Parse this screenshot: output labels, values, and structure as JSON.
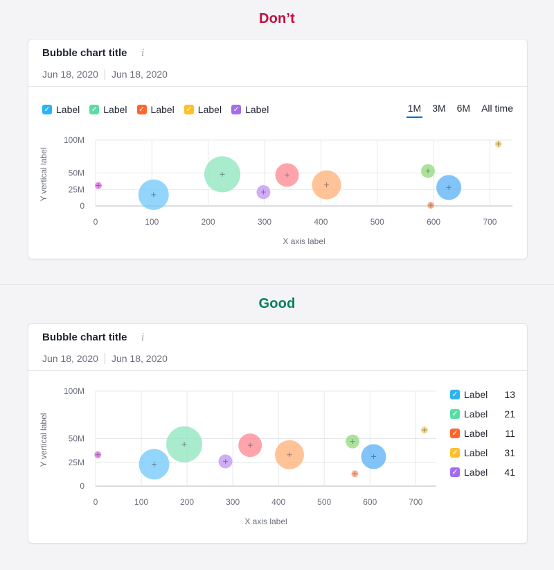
{
  "dont_heading": "Don’t",
  "good_heading": "Good",
  "card": {
    "title": "Bubble chart title",
    "info_icon": "i",
    "date_from": "Jun 18, 2020",
    "date_to": "Jun 18, 2020"
  },
  "legend": [
    {
      "label": "Label",
      "value": "13",
      "color": "#2bb3f3"
    },
    {
      "label": "Label",
      "value": "21",
      "color": "#59dda5"
    },
    {
      "label": "Label",
      "value": "11",
      "color": "#ff642d"
    },
    {
      "label": "Label",
      "value": "31",
      "color": "#ffbf2a"
    },
    {
      "label": "Label",
      "value": "41",
      "color": "#a56cf0"
    }
  ],
  "periods": [
    "1M",
    "3M",
    "6M",
    "All time"
  ],
  "active_period": "1M",
  "chart_data": [
    {
      "type": "scatter",
      "title": "",
      "xlabel": "X axis label",
      "ylabel": "Y vertical label",
      "xlim": [
        0,
        740
      ],
      "ylim": [
        0,
        100
      ],
      "x_ticks": [
        "0",
        "100",
        "200",
        "300",
        "400",
        "500",
        "600",
        "700"
      ],
      "y_ticks": [
        "0",
        "25M",
        "50M",
        "100M"
      ],
      "grid": true,
      "legend_position": "top",
      "points": [
        {
          "x": 5,
          "y": 31,
          "size": 5,
          "color": "#e070e8"
        },
        {
          "x": 103,
          "y": 17,
          "size": 22,
          "color": "#75c9fa"
        },
        {
          "x": 225,
          "y": 48,
          "size": 26,
          "color": "#8fe6bf"
        },
        {
          "x": 298,
          "y": 21,
          "size": 10,
          "color": "#c197f5"
        },
        {
          "x": 340,
          "y": 47,
          "size": 17,
          "color": "#ff8a93"
        },
        {
          "x": 410,
          "y": 32,
          "size": 21,
          "color": "#ffb27a"
        },
        {
          "x": 590,
          "y": 53,
          "size": 10,
          "color": "#96da80"
        },
        {
          "x": 595,
          "y": 1,
          "size": 5,
          "color": "#ff9f74"
        },
        {
          "x": 627,
          "y": 28,
          "size": 18,
          "color": "#5fb2f6"
        },
        {
          "x": 715,
          "y": 94,
          "size": 5,
          "color": "#ffd066"
        }
      ]
    },
    {
      "type": "scatter",
      "title": "",
      "xlabel": "X axis label",
      "ylabel": "Y vertical label",
      "xlim": [
        0,
        745
      ],
      "ylim": [
        0,
        100
      ],
      "x_ticks": [
        "0",
        "100",
        "200",
        "300",
        "400",
        "500",
        "600",
        "700"
      ],
      "y_ticks": [
        "0",
        "25M",
        "50M",
        "100M"
      ],
      "grid": true,
      "legend_position": "right",
      "points": [
        {
          "x": 5,
          "y": 33,
          "size": 5,
          "color": "#e070e8"
        },
        {
          "x": 128,
          "y": 23,
          "size": 22,
          "color": "#75c9fa"
        },
        {
          "x": 194,
          "y": 44,
          "size": 26,
          "color": "#8fe6bf"
        },
        {
          "x": 284,
          "y": 26,
          "size": 10,
          "color": "#c197f5"
        },
        {
          "x": 338,
          "y": 43,
          "size": 17,
          "color": "#ff8a93"
        },
        {
          "x": 424,
          "y": 33,
          "size": 21,
          "color": "#ffb27a"
        },
        {
          "x": 562,
          "y": 47,
          "size": 10,
          "color": "#96da80"
        },
        {
          "x": 567,
          "y": 13,
          "size": 5,
          "color": "#ff9f74"
        },
        {
          "x": 608,
          "y": 31,
          "size": 18,
          "color": "#5fb2f6"
        },
        {
          "x": 719,
          "y": 59,
          "size": 5,
          "color": "#ffd066"
        }
      ]
    }
  ]
}
